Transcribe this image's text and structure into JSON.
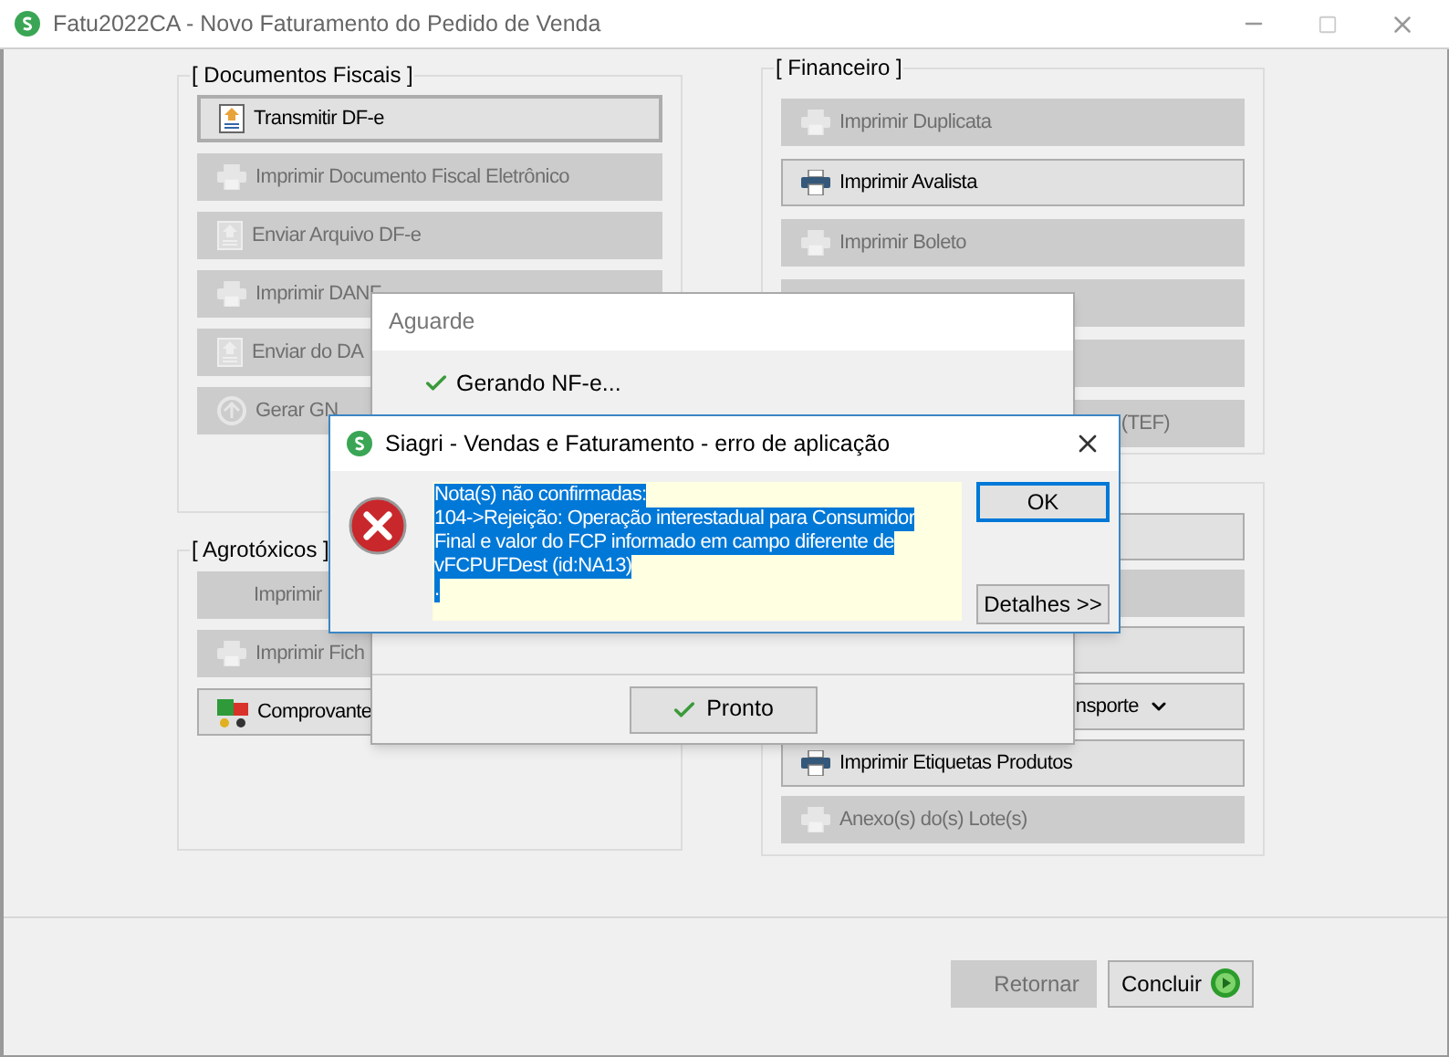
{
  "window": {
    "title": "Fatu2022CA - Novo Faturamento do Pedido de Venda"
  },
  "left_groups": [
    {
      "label": "[ Documentos Fiscais ]",
      "buttons": [
        {
          "label": "Transmitir DF-e",
          "kind": "upload",
          "disabled": false,
          "focused": true
        },
        {
          "label": "Imprimir Documento Fiscal Eletrônico",
          "kind": "printer",
          "disabled": true,
          "focused": false
        },
        {
          "label": "Enviar Arquivo DF-e",
          "kind": "upload",
          "disabled": true,
          "focused": false
        },
        {
          "label": "Imprimir DANF",
          "kind": "printer",
          "disabled": true,
          "focused": false
        },
        {
          "label": "Enviar do DA",
          "kind": "upload",
          "disabled": true,
          "focused": false
        },
        {
          "label": "Gerar GN",
          "kind": "globe",
          "disabled": true,
          "focused": false
        }
      ]
    },
    {
      "label": "[ Agrotóxicos ]",
      "buttons": [
        {
          "label": "Imprimir",
          "kind": "plain",
          "disabled": true,
          "focused": false
        },
        {
          "label": "Imprimir Fich",
          "kind": "printer",
          "disabled": true,
          "focused": false
        },
        {
          "label": "Comprovante",
          "kind": "truck",
          "disabled": false,
          "focused": false
        }
      ]
    }
  ],
  "right_groups": [
    {
      "label": "[ Financeiro ]",
      "buttons": [
        {
          "label": "Imprimir Duplicata",
          "kind": "printer",
          "disabled": true,
          "focused": false
        },
        {
          "label": "Imprimir Avalista",
          "kind": "printer",
          "disabled": false,
          "focused": false
        },
        {
          "label": "Imprimir Boleto",
          "kind": "printer",
          "disabled": true,
          "focused": false
        },
        {
          "kind": "plain",
          "disabled": true,
          "focused": false
        },
        {
          "kind": "plain",
          "disabled": true,
          "focused": false
        },
        {
          "label": "(TEF)",
          "kind": "partial",
          "disabled": true,
          "focused": false
        }
      ]
    },
    {
      "buttons": [
        {
          "kind": "plain",
          "disabled": false,
          "focused": false
        },
        {
          "kind": "plain",
          "disabled": true,
          "focused": false
        },
        {
          "kind": "plain",
          "disabled": false,
          "focused": false
        },
        {
          "label": "nsporte",
          "kind": "dropdown",
          "disabled": false,
          "focused": false
        },
        {
          "label": "Imprimir Etiquetas Produtos",
          "kind": "printer",
          "disabled": false,
          "focused": false
        },
        {
          "label": "Anexo(s) do(s) Lote(s)",
          "kind": "printer",
          "disabled": true,
          "focused": false
        }
      ]
    }
  ],
  "footer_buttons": [
    {
      "label": "Retornar",
      "disabled": true,
      "kind": "plain"
    },
    {
      "label": "Concluir",
      "disabled": false,
      "kind": "play"
    }
  ],
  "wait_dialog": {
    "title": "Aguarde",
    "steps": [
      {
        "label": "Gerando NF-e...",
        "done": true
      }
    ],
    "button": "Pronto"
  },
  "error_dialog": {
    "title": "Siagri - Vendas e Faturamento - erro de aplicação",
    "highlighted": true,
    "message_lines": [
      "Nota(s) não confirmadas:",
      "104->Rejeição: Operação interestadual para Consumidor",
      "Final e valor do FCP informado em campo diferente de",
      "vFCPUFDest (id:NA13)",
      "."
    ],
    "buttons": [
      {
        "label": "OK",
        "focused": true
      },
      {
        "label": "Detalhes >>",
        "focused": false
      }
    ]
  }
}
